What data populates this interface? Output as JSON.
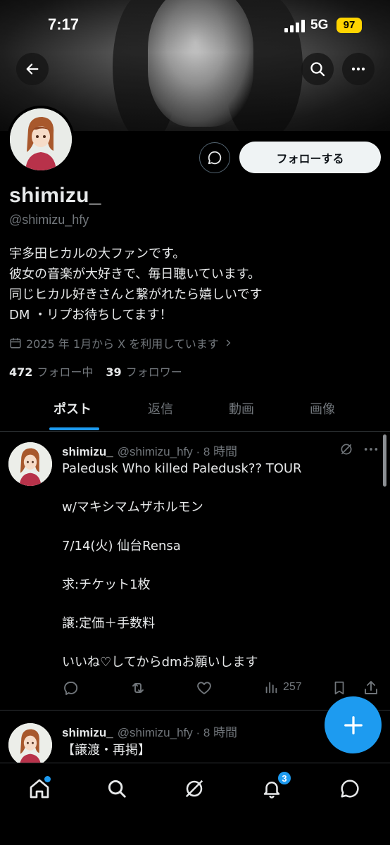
{
  "status_bar": {
    "time": "7:17",
    "network": "5G",
    "battery": "97"
  },
  "profile": {
    "follow_label": "フォローする",
    "name": "shimizu_",
    "handle": "@shimizu_hfy",
    "bio": [
      "宇多田ヒカルの大ファンです。",
      "彼女の音楽が大好きで、毎日聴いています。",
      "同じヒカル好きさんと繋がれたら嬉しいです",
      "DM ・リプお待ちしてます！"
    ],
    "joined": "2025 年 1月から X を利用しています",
    "following_count": "472",
    "following_label": "フォロー中",
    "followers_count": "39",
    "followers_label": "フォロワー"
  },
  "tabs": [
    {
      "label": "ポスト"
    },
    {
      "label": "返信"
    },
    {
      "label": "動画"
    },
    {
      "label": "画像"
    }
  ],
  "posts": [
    {
      "name": "shimizu_",
      "handle_time": "@shimizu_hfy · 8 時間",
      "lines": [
        "Paledusk Who killed Paledusk?? TOUR",
        "",
        "w/マキシマムザホルモン",
        "",
        "7/14(火) 仙台Rensa",
        "",
        "求:チケット1枚",
        "",
        "譲:定価＋手数料",
        "",
        "いいね♡してからdmお願いします"
      ],
      "views": "257"
    },
    {
      "name": "shimizu_",
      "handle_time": "@shimizu_hfy · 8 時間",
      "lines": [
        "【譲渡・再掲】"
      ]
    }
  ],
  "bottom_nav": {
    "notification_badge": "3"
  },
  "icons": {
    "back": "arrow-left-icon",
    "search": "search-icon",
    "more": "more-icon",
    "message": "message-icon",
    "calendar": "calendar-icon",
    "grok": "grok-icon",
    "reply": "reply-icon",
    "repost": "repost-icon",
    "like": "heart-icon",
    "views": "views-icon",
    "bookmark": "bookmark-icon",
    "share": "share-icon",
    "compose": "plus-icon",
    "home": "home-icon",
    "notifications": "bell-icon",
    "messages": "messages-icon"
  },
  "colors": {
    "accent": "#1d9bf0",
    "background": "#000000",
    "muted": "#71767b",
    "battery": "#ffd400"
  }
}
